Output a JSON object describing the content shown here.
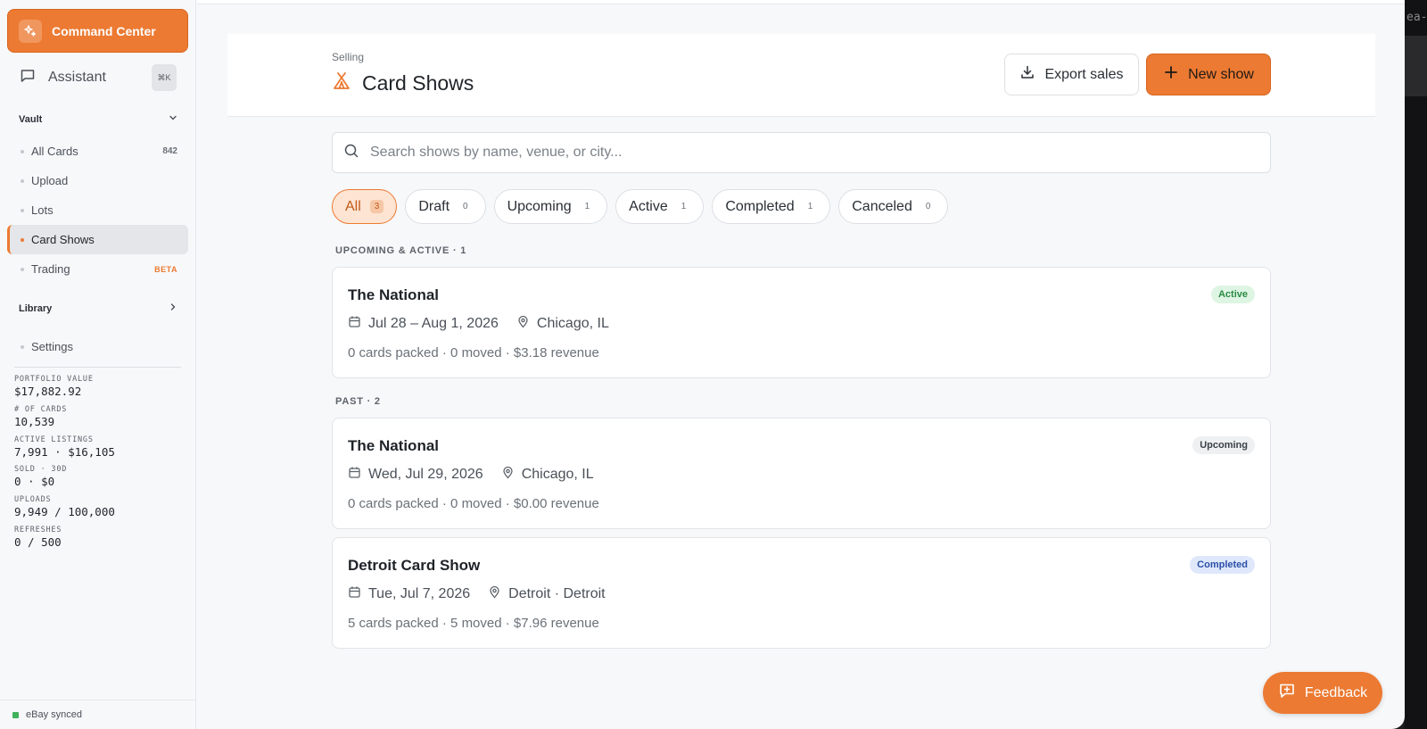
{
  "colors": {
    "accent": "#ec7a32",
    "active_green": "#2a8a43",
    "completed_blue": "#2b4fa8"
  },
  "background_tab_fragment": "ea-c",
  "sidebar": {
    "command_center": "Command Center",
    "assistant": "Assistant",
    "assistant_shortcut": "⌘K",
    "vault_header": "Vault",
    "vault_items": [
      {
        "label": "All Cards",
        "count": "842"
      },
      {
        "label": "Upload"
      },
      {
        "label": "Lots"
      },
      {
        "label": "Card Shows",
        "active": true
      },
      {
        "label": "Trading",
        "badge": "BETA"
      }
    ],
    "library_header": "Library",
    "settings": "Settings",
    "stats": [
      {
        "label": "PORTFOLIO VALUE",
        "value": "$17,882.92"
      },
      {
        "label": "# OF CARDS",
        "value": "10,539"
      },
      {
        "label": "ACTIVE LISTINGS",
        "value": "7,991 · $16,105"
      },
      {
        "label": "SOLD · 30D",
        "value": "0 · $0"
      },
      {
        "label": "UPLOADS",
        "value": "9,949 / 100,000"
      },
      {
        "label": "REFRESHES",
        "value": "0 / 500"
      }
    ],
    "sync_status": "eBay synced"
  },
  "header": {
    "breadcrumb": "Selling",
    "title": "Card Shows",
    "export_label": "Export sales",
    "new_label": "New show"
  },
  "search": {
    "placeholder": "Search shows by name, venue, or city...",
    "value": ""
  },
  "filters": [
    {
      "label": "All",
      "count": "3",
      "active": true
    },
    {
      "label": "Draft",
      "count": "0"
    },
    {
      "label": "Upcoming",
      "count": "1"
    },
    {
      "label": "Active",
      "count": "1"
    },
    {
      "label": "Completed",
      "count": "1"
    },
    {
      "label": "Canceled",
      "count": "0"
    }
  ],
  "groups": {
    "upcoming_active": "UPCOMING & ACTIVE · 1",
    "past": "PAST · 2"
  },
  "shows": [
    {
      "name": "The National",
      "date": "Jul 28 – Aug 1, 2026",
      "location": "Chicago, IL",
      "summary": "0 cards packed · 0 moved · $3.18 revenue",
      "status": "Active"
    },
    {
      "name": "The National",
      "date": "Wed, Jul 29, 2026",
      "location": "Chicago, IL",
      "summary": "0 cards packed · 0 moved · $0.00 revenue",
      "status": "Upcoming"
    },
    {
      "name": "Detroit Card Show",
      "date": "Tue, Jul 7, 2026",
      "location": "Detroit · Detroit",
      "summary": "5 cards packed · 5 moved · $7.96 revenue",
      "status": "Completed"
    }
  ],
  "feedback_label": "Feedback"
}
